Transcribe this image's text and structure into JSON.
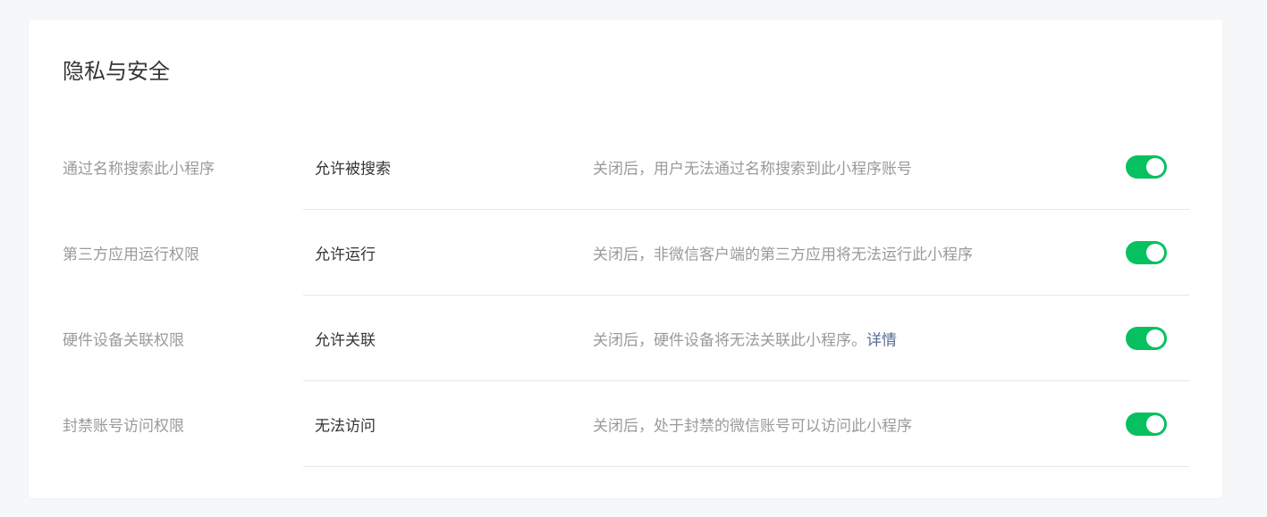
{
  "section": {
    "title": "隐私与安全"
  },
  "settings": [
    {
      "label": "通过名称搜索此小程序",
      "value": "允许被搜索",
      "description": "关闭后，用户无法通过名称搜索到此小程序账号",
      "link": "",
      "enabled": true
    },
    {
      "label": "第三方应用运行权限",
      "value": "允许运行",
      "description": "关闭后，非微信客户端的第三方应用将无法运行此小程序",
      "link": "",
      "enabled": true
    },
    {
      "label": "硬件设备关联权限",
      "value": "允许关联",
      "description": "关闭后，硬件设备将无法关联此小程序。",
      "link": "详情",
      "enabled": true
    },
    {
      "label": "封禁账号访问权限",
      "value": "无法访问",
      "description": "关闭后，处于封禁的微信账号可以访问此小程序",
      "link": "",
      "enabled": true
    }
  ],
  "colors": {
    "toggle_on": "#07c160",
    "link": "#576b95",
    "muted_text": "#9a9a9a",
    "primary_text": "#353535"
  }
}
